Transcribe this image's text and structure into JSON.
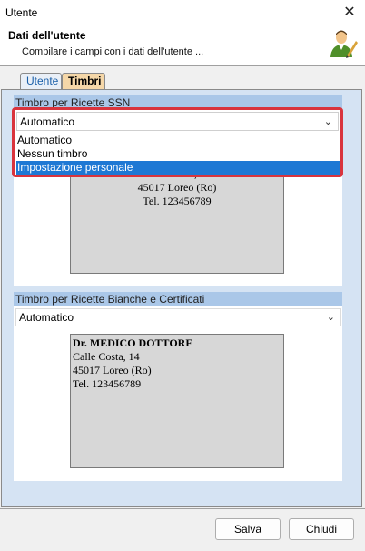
{
  "window": {
    "title": "Utente"
  },
  "header": {
    "title": "Dati dell'utente",
    "subtitle": "Compilare i campi con i dati dell'utente ..."
  },
  "tabs": [
    {
      "label": "Utente",
      "active": false
    },
    {
      "label": "Timbri",
      "active": true
    }
  ],
  "ssn_group": {
    "title": "Timbro per Ricette SSN",
    "selected": "Automatico",
    "options": [
      "Automatico",
      "Nessun timbro",
      "Impostazione personale"
    ],
    "highlighted_option": "Impostazione personale",
    "stamp": {
      "line1": "Calle Costa, 14",
      "line2": "45017 Loreo (Ro)",
      "line3": "Tel. 123456789"
    }
  },
  "white_group": {
    "title": "Timbro per Ricette Bianche e Certificati",
    "selected": "Automatico",
    "stamp": {
      "name": "Dr. MEDICO DOTTORE",
      "line1": "Calle Costa, 14",
      "line2": "45017 Loreo  (Ro)",
      "line3": "Tel. 123456789"
    }
  },
  "buttons": {
    "save": "Salva",
    "close": "Chiudi"
  },
  "colors": {
    "highlight": "#1e78d4",
    "focus_border": "#d9343d",
    "group_header": "#aac7e8",
    "active_tab": "#f5d7a8"
  }
}
